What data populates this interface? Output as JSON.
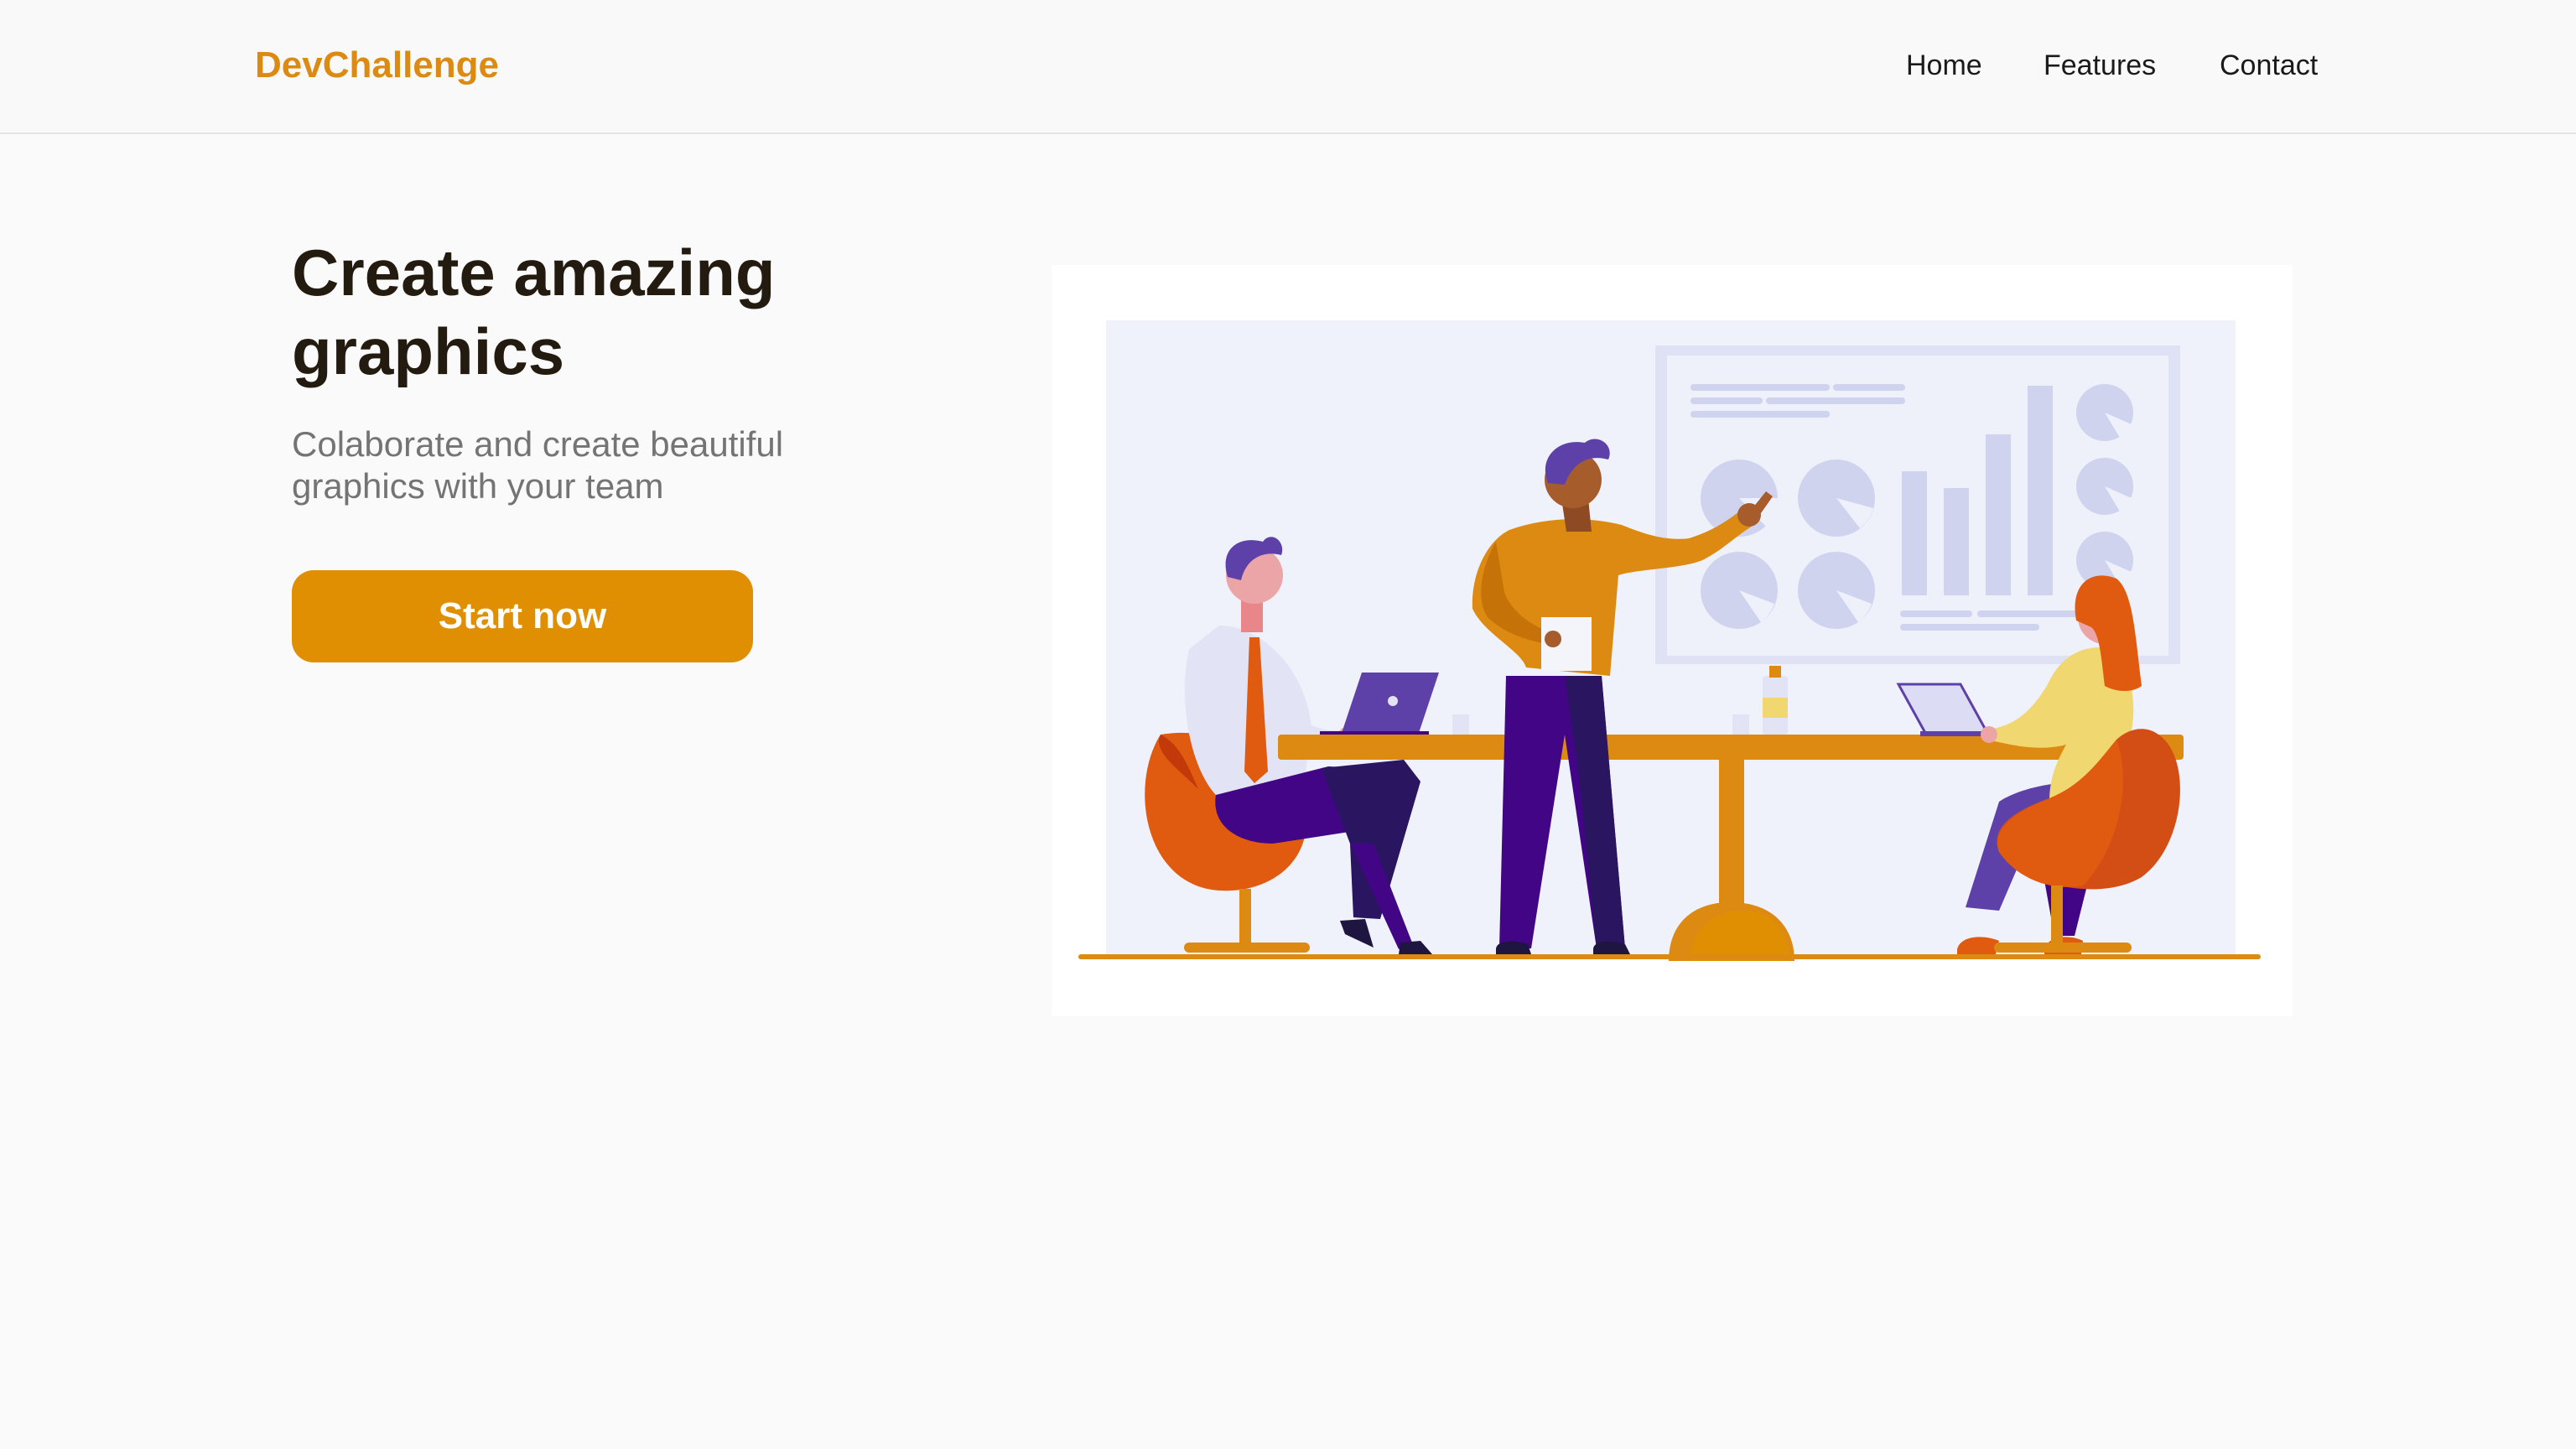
{
  "nav": {
    "logo": "DevChallenge",
    "links": [
      "Home",
      "Features",
      "Contact"
    ]
  },
  "hero": {
    "title": "Create amazing graphics",
    "subtitle": "Colaborate and create beautiful graphics with your team",
    "cta_label": "Start now"
  },
  "colors": {
    "brand_orange": "#e08f02",
    "logo_orange": "#dd8a12",
    "title_dark": "#231b10",
    "subtitle_gray": "#747474",
    "page_background": "#fafafa",
    "illustration_backdrop": "#f0f2fb",
    "purple": "#410585"
  },
  "illustration": {
    "name": "team-meeting-illustration"
  }
}
